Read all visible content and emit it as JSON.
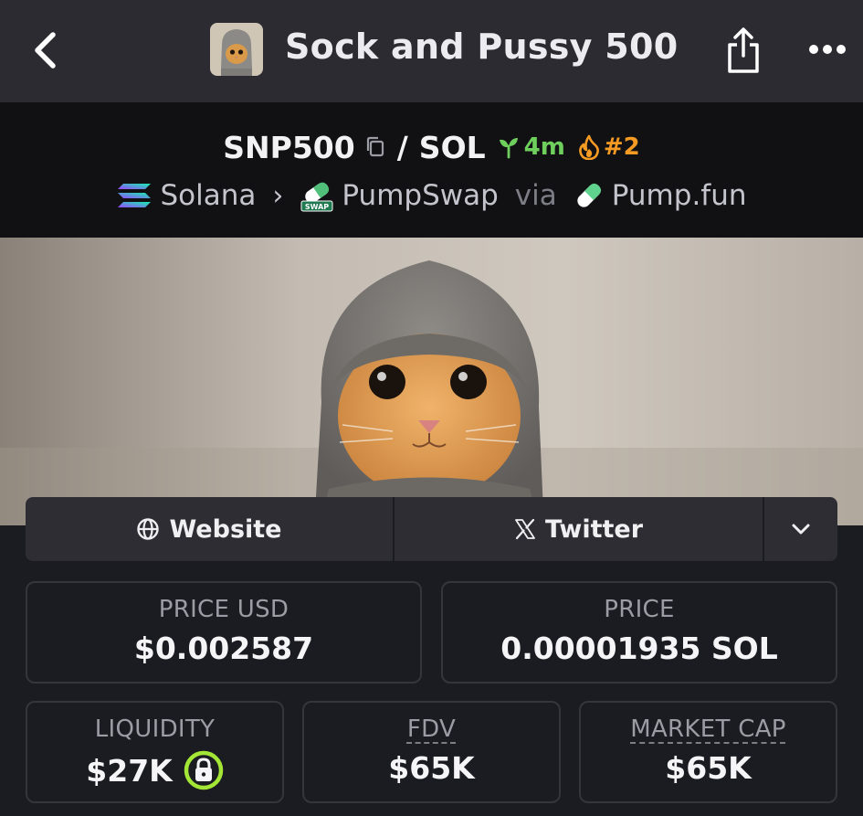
{
  "header": {
    "title": "Sock and Pussy 500"
  },
  "pair": {
    "base": "SNP500",
    "separator": "/",
    "quote": "SOL",
    "age": "4m",
    "rank": "#2"
  },
  "route": {
    "chain": "Solana",
    "dex": "PumpSwap",
    "dex_logo_text": "SWAP",
    "via": "via",
    "launchpad": "Pump.fun"
  },
  "links": {
    "website": "Website",
    "twitter": "Twitter"
  },
  "stats": {
    "price_usd": {
      "label": "PRICE USD",
      "value": "$0.002587"
    },
    "price": {
      "label": "PRICE",
      "value": "0.00001935 SOL"
    },
    "liquidity": {
      "label": "LIQUIDITY",
      "value": "$27K"
    },
    "fdv": {
      "label": "FDV",
      "value": "$65K"
    },
    "market_cap": {
      "label": "MARKET CAP",
      "value": "$65K"
    }
  },
  "colors": {
    "background": "#1b1b22",
    "topbar": "#2b2b31",
    "pairbar": "#111114",
    "age_green": "#6fcf5d",
    "rank_orange": "#f59a23",
    "lock_green": "#a3e635"
  },
  "icons": {
    "back": "chevron-left-icon",
    "share": "share-icon",
    "more": "ellipsis-icon",
    "copy": "copy-icon",
    "age": "sprout-icon",
    "rank": "flame-icon",
    "chain": "solana-icon",
    "dex": "pumpswap-pill-icon",
    "launchpad": "pill-icon",
    "website": "globe-icon",
    "twitter": "x-logo-icon",
    "expand": "chevron-down-icon",
    "liquidity_lock": "lock-icon"
  }
}
